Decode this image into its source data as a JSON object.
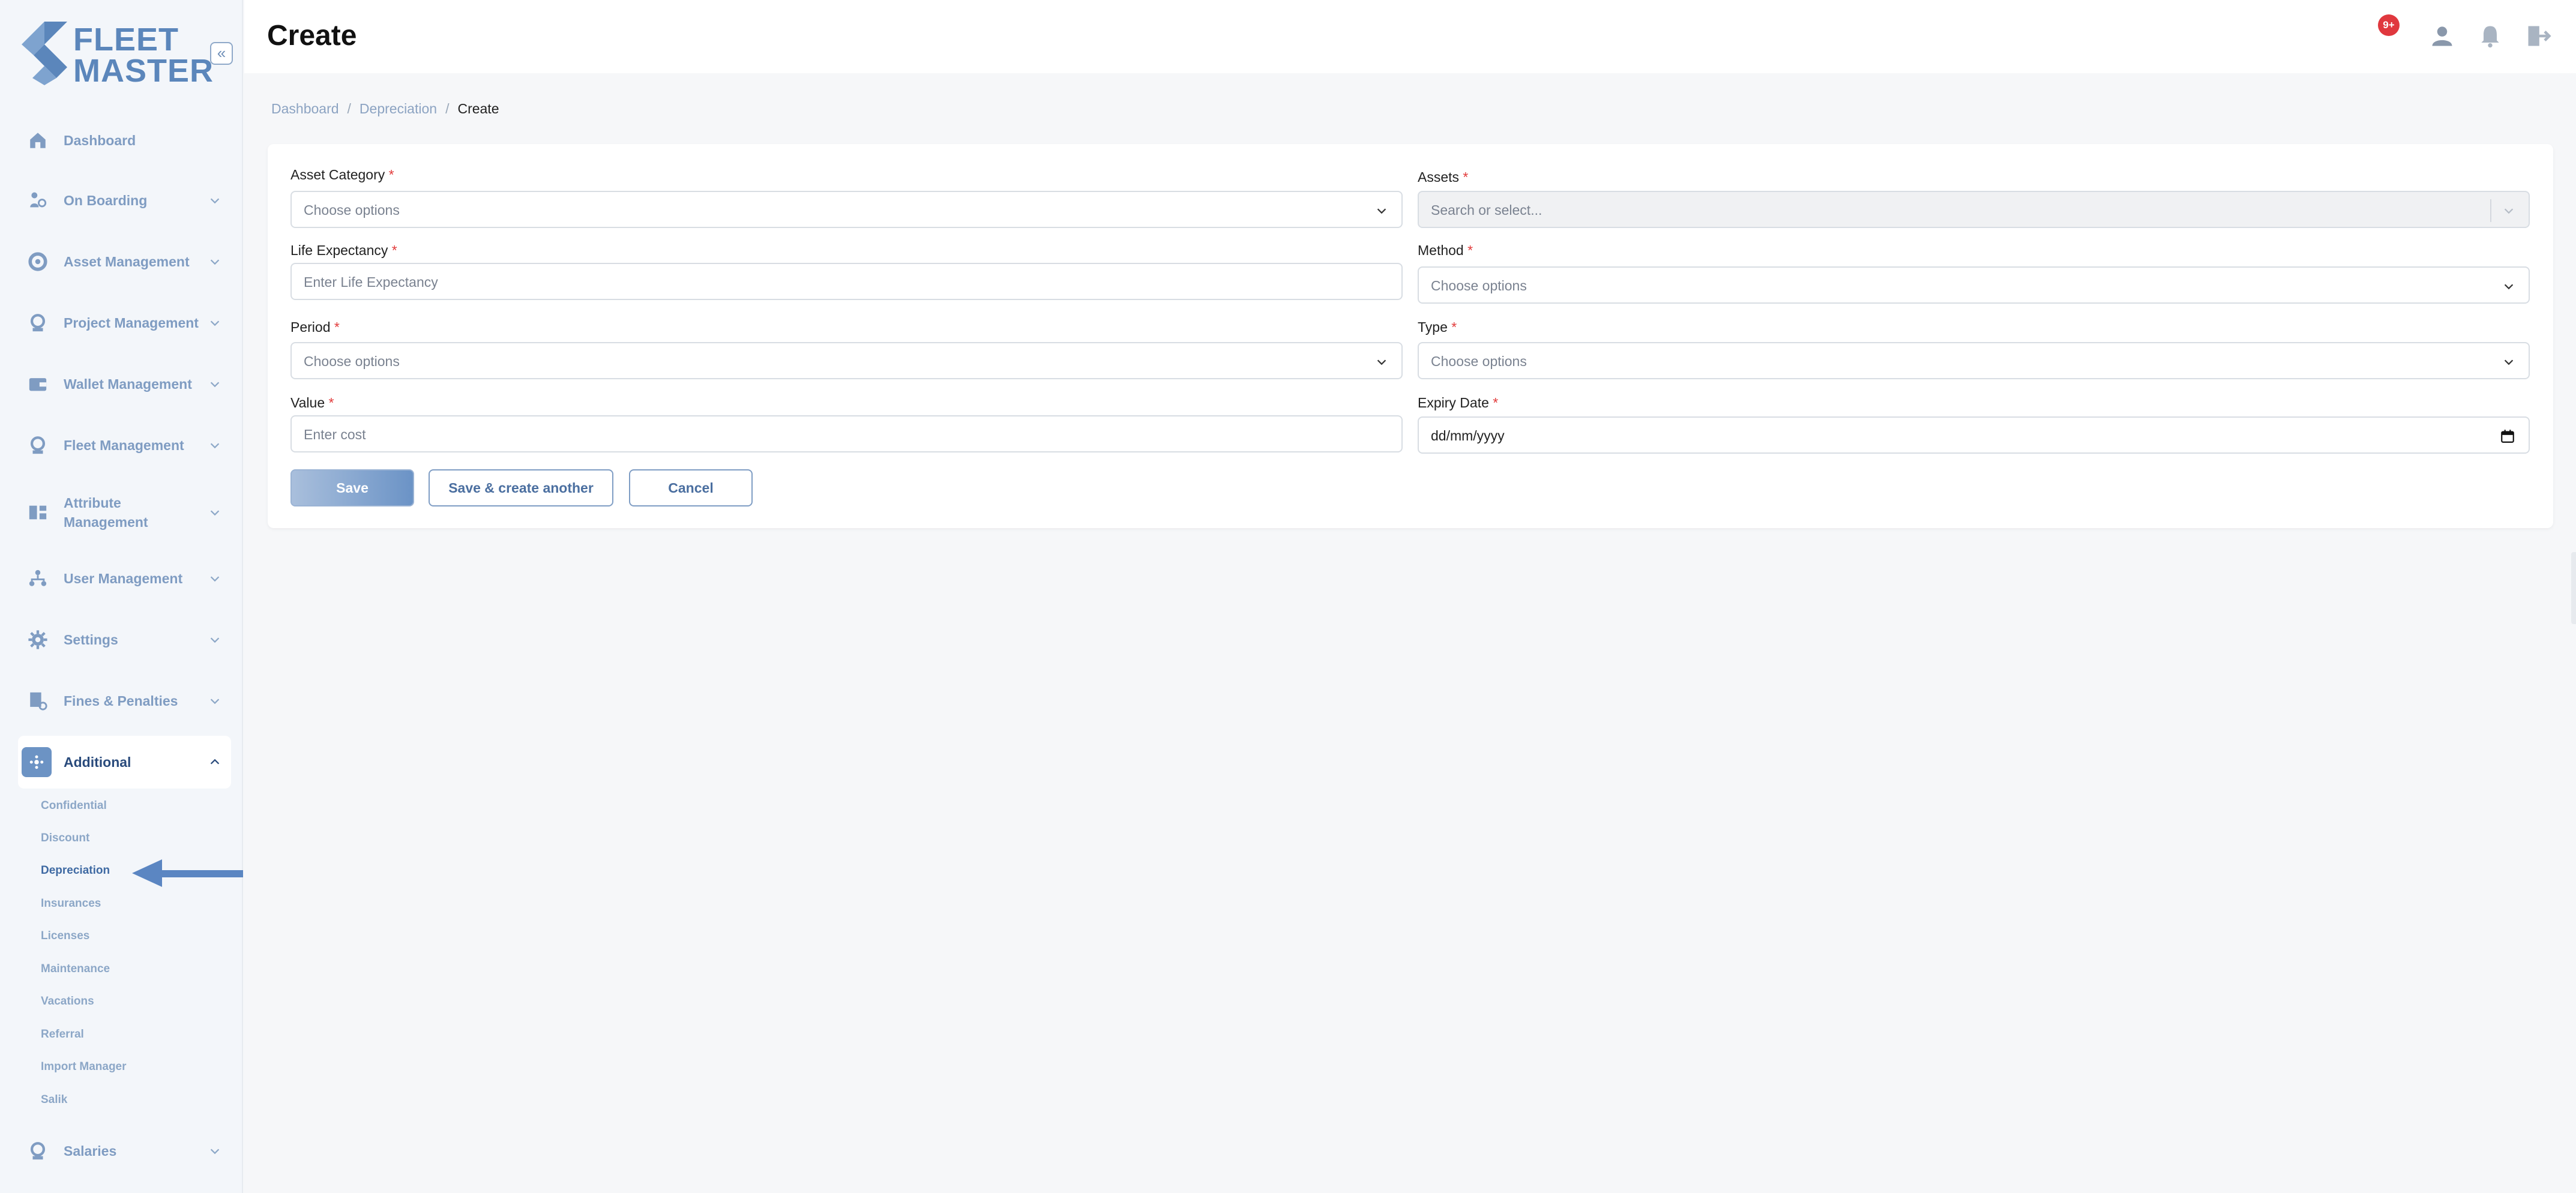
{
  "app": {
    "logo_line1": "FLEET",
    "logo_line2": "MASTER",
    "collapse_icon": "double-chevron-left-icon"
  },
  "sidebar": {
    "items": [
      {
        "label": "Dashboard",
        "icon": "home-icon",
        "has_chevron": false
      },
      {
        "label": "On Boarding",
        "icon": "onboarding-icon",
        "has_chevron": true
      },
      {
        "label": "Asset Management",
        "icon": "asset-icon",
        "has_chevron": true
      },
      {
        "label": "Project Management",
        "icon": "project-icon",
        "has_chevron": true
      },
      {
        "label": "Wallet Management",
        "icon": "wallet-icon",
        "has_chevron": true
      },
      {
        "label": "Fleet Management",
        "icon": "fleet-icon",
        "has_chevron": true
      },
      {
        "label": "Attribute Management",
        "icon": "attribute-icon",
        "has_chevron": true
      },
      {
        "label": "User Management",
        "icon": "users-icon",
        "has_chevron": true
      },
      {
        "label": "Settings",
        "icon": "gear-icon",
        "has_chevron": true
      },
      {
        "label": "Fines & Penalties",
        "icon": "fines-icon",
        "has_chevron": true
      },
      {
        "label": "Additional",
        "icon": "additional-icon",
        "has_chevron": true,
        "active": true
      },
      {
        "label": "Salaries",
        "icon": "salaries-icon",
        "has_chevron": true
      }
    ],
    "attribute_label_line1": "Attribute",
    "attribute_label_line2": "Management",
    "sub_items": [
      "Confidential",
      "Discount",
      "Depreciation",
      "Insurances",
      "Licenses",
      "Maintenance",
      "Vacations",
      "Referral",
      "Import Manager",
      "Salik"
    ],
    "current_sub": "Depreciation"
  },
  "header": {
    "title": "Create",
    "notification_badge": "9+",
    "icons": [
      "user-icon",
      "bell-icon",
      "logout-icon"
    ]
  },
  "breadcrumb": {
    "items": [
      "Dashboard",
      "Depreciation"
    ],
    "current": "Create",
    "separator": "/"
  },
  "form": {
    "asset_category": {
      "label": "Asset Category",
      "placeholder": "Choose options"
    },
    "assets": {
      "label": "Assets",
      "placeholder": "Search or select..."
    },
    "life_expectancy": {
      "label": "Life Expectancy",
      "placeholder": "Enter Life Expectancy"
    },
    "method": {
      "label": "Method",
      "placeholder": "Choose options"
    },
    "period": {
      "label": "Period",
      "placeholder": "Choose options"
    },
    "type": {
      "label": "Type",
      "placeholder": "Choose options"
    },
    "value": {
      "label": "Value",
      "placeholder": "Enter cost"
    },
    "expiry_date": {
      "label": "Expiry Date",
      "value": "dd/mm/yyyy"
    },
    "required_mark": "*"
  },
  "actions": {
    "save": "Save",
    "save_another": "Save & create another",
    "cancel": "Cancel"
  },
  "colors": {
    "accent": "#6b93c6",
    "nav_text": "#7f9cc2",
    "required": "#e23b3b",
    "badge": "#e0383e"
  }
}
